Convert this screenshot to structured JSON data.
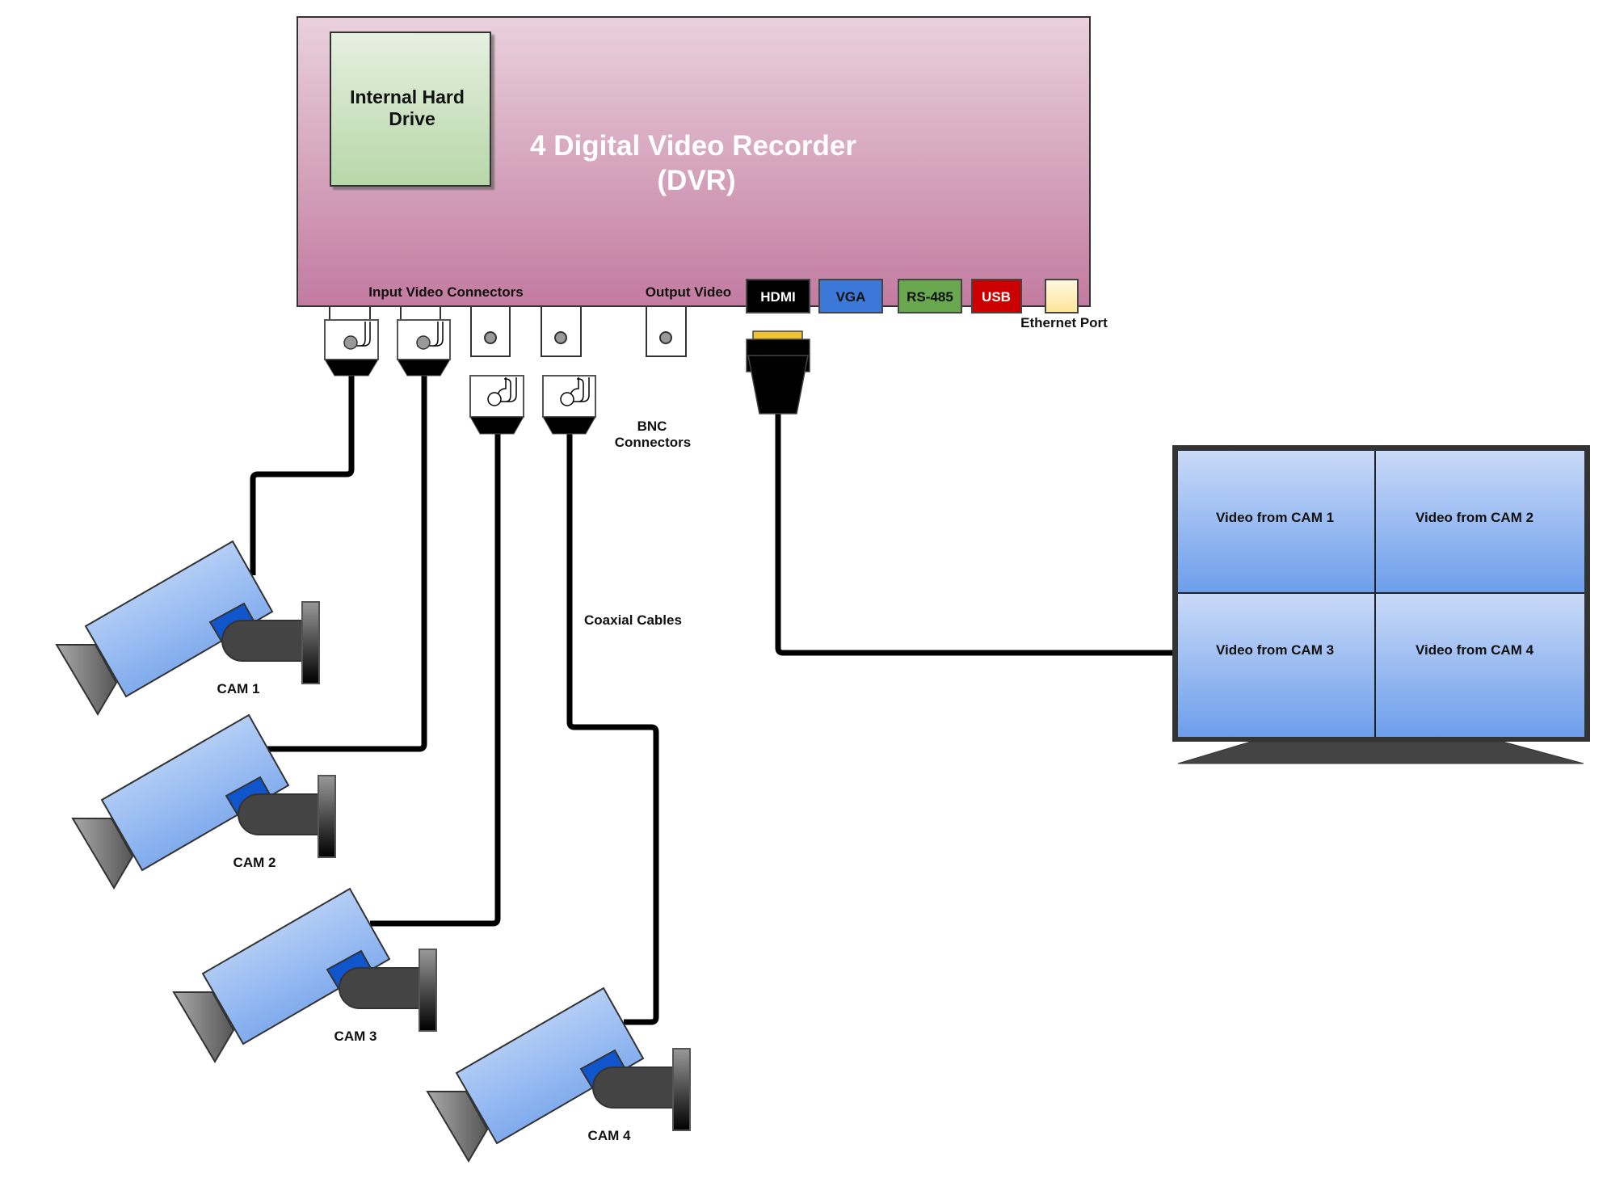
{
  "dvr": {
    "title_line1": "4 Digital Video Recorder",
    "title_line2": "(DVR)",
    "hdd_line1": "Internal Hard",
    "hdd_line2": "Drive",
    "input_label": "Input Video Connectors",
    "output_label": "Output Video",
    "ports": [
      {
        "label": "HDMI",
        "color": "#000000",
        "text_color": "#ffffff"
      },
      {
        "label": "VGA",
        "color": "#3c78d8",
        "text_color": "#111111"
      },
      {
        "label": "RS-485",
        "color": "#6aa84f",
        "text_color": "#111111"
      },
      {
        "label": "USB",
        "color": "#cc0000",
        "text_color": "#ffffff"
      },
      {
        "label": "",
        "color": "#fff2cc",
        "text_color": "#111111"
      }
    ],
    "ethernet_label": "Ethernet Port"
  },
  "annotations": {
    "bnc_line1": "BNC",
    "bnc_line2": "Connectors",
    "coax": "Coaxial Cables"
  },
  "cameras": [
    {
      "label": "CAM 1"
    },
    {
      "label": "CAM 2"
    },
    {
      "label": "CAM 3"
    },
    {
      "label": "CAM 4"
    }
  ],
  "monitor": {
    "tiles": [
      "Video from CAM 1",
      "Video from CAM 2",
      "Video from CAM 3",
      "Video from CAM 4"
    ]
  },
  "colors": {
    "dvr_top": "#ead1dc",
    "dvr_bottom": "#c27ba0",
    "hdd_top": "#e6f0e0",
    "hdd_bottom": "#b6d7a8",
    "screen_top": "#c9daf8",
    "screen_bottom": "#6d9eeb",
    "hdmi_tip": "#f1c232"
  }
}
